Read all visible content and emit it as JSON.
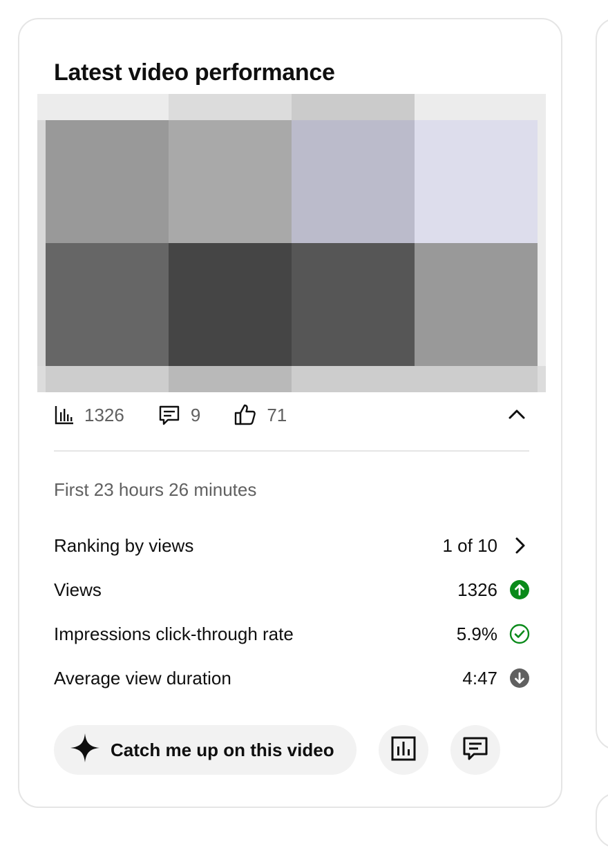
{
  "card": {
    "title": "Latest video performance"
  },
  "stats": {
    "views": "1326",
    "comments": "9",
    "likes": "71"
  },
  "details": {
    "period": "First 23 hours 26 minutes",
    "metrics": [
      {
        "label": "Ranking by views",
        "value": "1 of 10",
        "indicator": "chevron-right-icon"
      },
      {
        "label": "Views",
        "value": "1326",
        "indicator": "arrow-up-circle-icon"
      },
      {
        "label": "Impressions click-through rate",
        "value": "5.9%",
        "indicator": "check-circle-icon"
      },
      {
        "label": "Average view duration",
        "value": "4:47",
        "indicator": "arrow-down-circle-icon"
      }
    ]
  },
  "actions": {
    "catch_up_label": "Catch me up on this video"
  },
  "colors": {
    "positive": "#0a8a1a",
    "neutral_down": "#606060",
    "chip_bg": "#f2f2f2",
    "border": "#e5e5e5"
  }
}
